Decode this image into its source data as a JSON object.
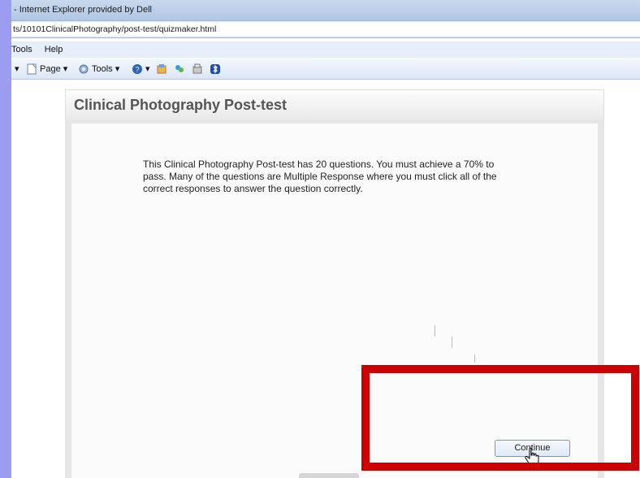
{
  "browser": {
    "title": "- Internet Explorer provided by Dell",
    "address": "ts/10101ClinicalPhotography/post-test/quizmaker.html",
    "menu": [
      "Tools",
      "Help"
    ],
    "commands": {
      "page_label": "Page",
      "tools_label": "Tools"
    }
  },
  "quiz": {
    "title": "Clinical Photography Post-test",
    "intro": "This Clinical Photography Post-test has 20 questions. You must achieve a 70% to pass. Many of the questions are Multiple Response where you must click all of the correct responses to answer the question correctly.",
    "continue_label": "Continue"
  },
  "colors": {
    "highlight": "#cc0000",
    "background": "#9c9cf0"
  }
}
